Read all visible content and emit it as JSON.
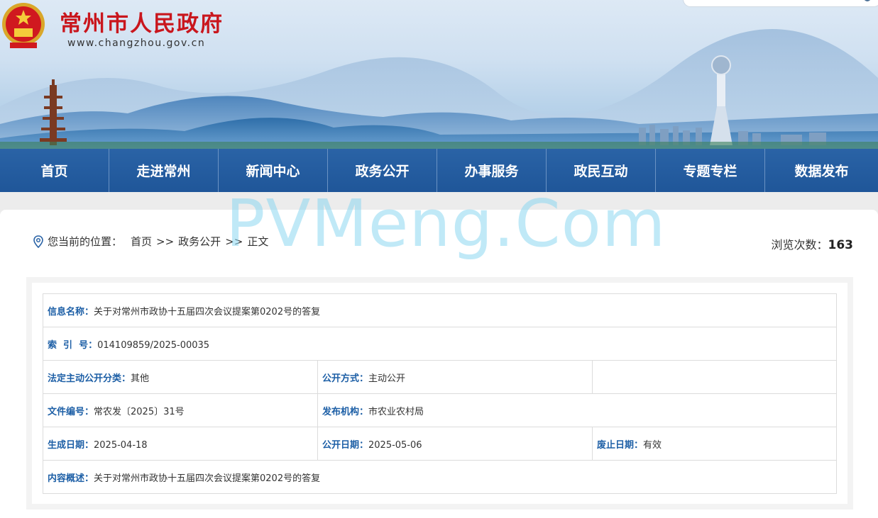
{
  "header": {
    "site_title": "常州市人民政府",
    "site_url": "www.changzhou.gov.cn"
  },
  "nav": [
    "首页",
    "走进常州",
    "新闻中心",
    "政务公开",
    "办事服务",
    "政民互动",
    "专题专栏",
    "数据发布"
  ],
  "location": {
    "label": "您当前的位置：",
    "crumbs": [
      "首页",
      "政务公开",
      "正文"
    ],
    "separator": ">>"
  },
  "views": {
    "label": "浏览次数：",
    "count": "163"
  },
  "info": {
    "name_label": "信息名称：",
    "name": "关于对常州市政协十五届四次会议提案第0202号的答复",
    "index_label": "索  引  号：",
    "index": "014109859/2025-00035",
    "category_label": "法定主动公开分类：",
    "category": "其他",
    "method_label": "公开方式：",
    "method": "主动公开",
    "doc_no_label": "文件编号：",
    "doc_no": "常农发〔2025〕31号",
    "publisher_label": "发布机构：",
    "publisher": "市农业农村局",
    "created_label": "生成日期：",
    "created": "2025-04-18",
    "published_label": "公开日期：",
    "published": "2025-05-06",
    "expiry_label": "废止日期：",
    "expiry": "有效",
    "summary_label": "内容概述：",
    "summary": "关于对常州市政协十五届四次会议提案第0202号的答复"
  },
  "watermark": "PVMeng.Com",
  "colors": {
    "nav_bg": "#2360a3",
    "title_red": "#c9161d",
    "label_blue": "#1d5fa6"
  }
}
